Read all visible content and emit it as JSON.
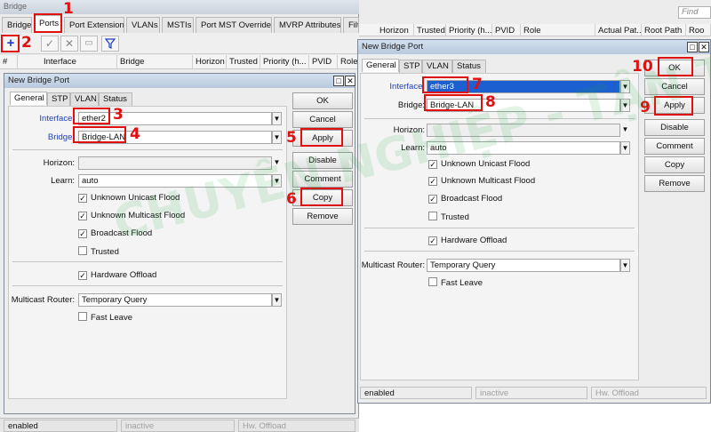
{
  "bridge_window": {
    "title": "Bridge",
    "tabs": [
      "Bridge",
      "Ports",
      "Port Extensions",
      "VLANs",
      "MSTIs",
      "Port MST Overrides",
      "MVRP Attributes",
      "Filte"
    ],
    "toolbar_icons": [
      "add-icon",
      "check-icon",
      "cross-icon",
      "comment-icon",
      "filter-icon"
    ],
    "columns": [
      "#",
      "Interface",
      "Bridge",
      "Horizon",
      "Trusted",
      "Priority (h...",
      "PVID",
      "Role"
    ],
    "status": [
      "enabled",
      "inactive",
      "Hw. Offload"
    ],
    "right_columns": [
      "Horizon",
      "Trusted",
      "Priority (h...",
      "PVID",
      "Role",
      "Actual Pat...",
      "Root Path",
      "Roo"
    ],
    "find_placeholder": "Find"
  },
  "left_dialog": {
    "title": "New Bridge Port",
    "tabs": [
      "General",
      "STP",
      "VLAN",
      "Status"
    ],
    "labels": {
      "interface": "Interface:",
      "bridge": "Bridge:",
      "horizon": "Horizon:",
      "learn": "Learn:",
      "multicast_router": "Multicast Router:"
    },
    "values": {
      "interface": "ether2",
      "bridge": "Bridge-LAN",
      "horizon": "",
      "learn": "auto",
      "multicast_router": "Temporary Query"
    },
    "checks": {
      "unknown_unicast_flood": "Unknown Unicast Flood",
      "unknown_multicast_flood": "Unknown Multicast Flood",
      "broadcast_flood": "Broadcast Flood",
      "trusted": "Trusted",
      "hardware_offload": "Hardware Offload",
      "fast_leave": "Fast Leave"
    },
    "checked": {
      "unknown_unicast_flood": true,
      "unknown_multicast_flood": true,
      "broadcast_flood": true,
      "trusted": false,
      "hardware_offload": true,
      "fast_leave": false
    },
    "buttons": [
      "OK",
      "Cancel",
      "Apply",
      "Disable",
      "Comment",
      "Copy",
      "Remove"
    ],
    "status": [
      "enabled",
      "inactive",
      "Hw. Offload"
    ]
  },
  "right_dialog": {
    "title": "New Bridge Port",
    "tabs": [
      "General",
      "STP",
      "VLAN",
      "Status"
    ],
    "labels": {
      "interface": "Interface:",
      "bridge": "Bridge:",
      "horizon": "Horizon:",
      "learn": "Learn:",
      "multicast_router": "Multicast Router:"
    },
    "values": {
      "interface": "ether3",
      "bridge": "Bridge-LAN",
      "horizon": "",
      "learn": "auto",
      "multicast_router": "Temporary Query"
    },
    "checks": {
      "unknown_unicast_flood": "Unknown Unicast Flood",
      "unknown_multicast_flood": "Unknown Multicast Flood",
      "broadcast_flood": "Broadcast Flood",
      "trusted": "Trusted",
      "hardware_offload": "Hardware Offload",
      "fast_leave": "Fast Leave"
    },
    "checked": {
      "unknown_unicast_flood": true,
      "unknown_multicast_flood": true,
      "broadcast_flood": true,
      "trusted": false,
      "hardware_offload": true,
      "fast_leave": false
    },
    "buttons": [
      "OK",
      "Cancel",
      "Apply",
      "Disable",
      "Comment",
      "Copy",
      "Remove"
    ],
    "status": [
      "enabled",
      "inactive",
      "Hw. Offload"
    ]
  },
  "annotations": [
    "1",
    "2",
    "3",
    "4",
    "5",
    "6",
    "7",
    "8",
    "9",
    "10"
  ],
  "watermark": "CHUYÊN NGHIỆP - TẬN THIỆN",
  "colors": {
    "annotation": "#e01010",
    "link_label": "#1c3fbf",
    "selection": "#1b5fd1"
  }
}
